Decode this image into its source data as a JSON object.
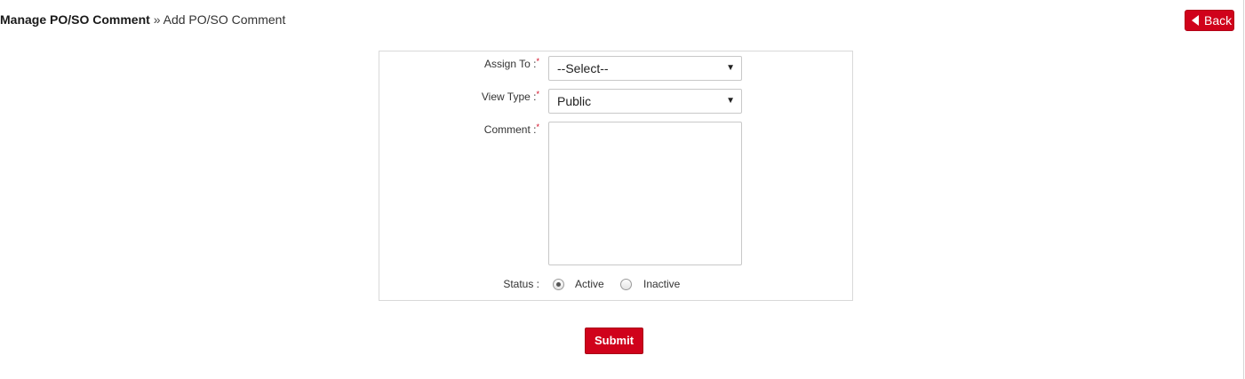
{
  "breadcrumb": {
    "root": "Manage PO/SO Comment",
    "separator": "»",
    "current": "Add PO/SO Comment"
  },
  "header": {
    "back_label": "Back",
    "back_icon": "triangle-left-icon"
  },
  "form": {
    "required_marker": "*",
    "assign_to": {
      "label": "Assign To :",
      "value": "--Select--"
    },
    "view_type": {
      "label": "View Type :",
      "value": "Public"
    },
    "comment": {
      "label": "Comment :",
      "value": ""
    },
    "status": {
      "label": "Status :",
      "options": [
        {
          "label": "Active",
          "checked": true
        },
        {
          "label": "Inactive",
          "checked": false
        }
      ]
    },
    "submit_label": "Submit"
  },
  "colors": {
    "accent": "#d0021b",
    "border": "#d9d9d9"
  }
}
